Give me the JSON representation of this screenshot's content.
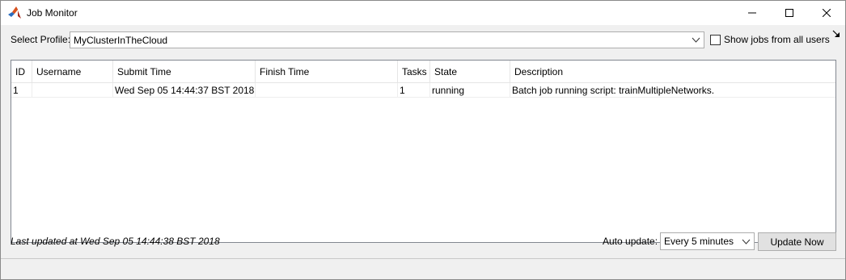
{
  "window": {
    "title": "Job Monitor",
    "controls": [
      "minimize-icon",
      "maximize-icon",
      "close-icon"
    ]
  },
  "profile": {
    "label": "Select Profile:",
    "selected": "MyClusterInTheCloud",
    "show_all_label": "Show jobs from all users",
    "show_all_checked": false
  },
  "table": {
    "columns": [
      "ID",
      "Username",
      "Submit Time",
      "Finish Time",
      "Tasks",
      "State",
      "Description"
    ],
    "rows": [
      {
        "id": "1",
        "username": "",
        "submit_time": "Wed Sep 05 14:44:37 BST 2018",
        "finish_time": "",
        "tasks": "1",
        "state": "running",
        "description": "Batch job running script: trainMultipleNetworks."
      }
    ]
  },
  "footer": {
    "last_updated": "Last updated at Wed Sep 05 14:44:38 BST 2018",
    "auto_update_label": "Auto update:",
    "auto_update_value": "Every 5 minutes",
    "update_button": "Update Now"
  },
  "colors": {
    "matlab_orange": "#d9531e",
    "matlab_red": "#a5281b",
    "matlab_blue": "#2a6cbf"
  }
}
